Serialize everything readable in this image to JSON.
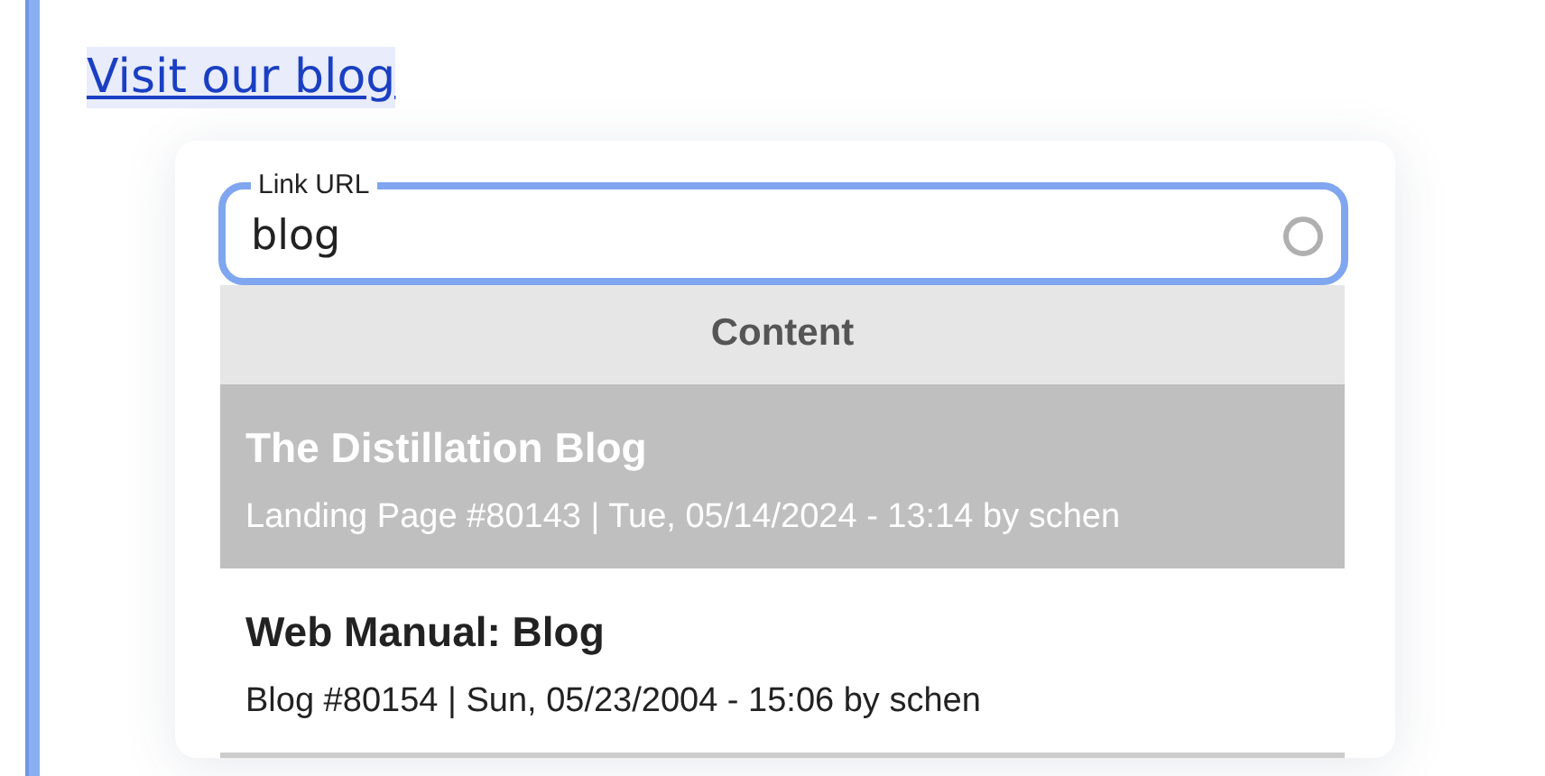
{
  "link": {
    "text": "Visit our blog",
    "selected": true
  },
  "url_field": {
    "label": "Link URL",
    "value": "blog",
    "loading": true
  },
  "results": {
    "heading": "Content",
    "items": [
      {
        "title": "The Distillation Blog",
        "meta": "Landing Page #80143 | Tue, 05/14/2024 - 13:14 by schen",
        "selected": true
      },
      {
        "title": "Web Manual: Blog",
        "meta": "Blog #80154 | Sun, 05/23/2004 - 15:06 by schen",
        "selected": false
      }
    ]
  }
}
